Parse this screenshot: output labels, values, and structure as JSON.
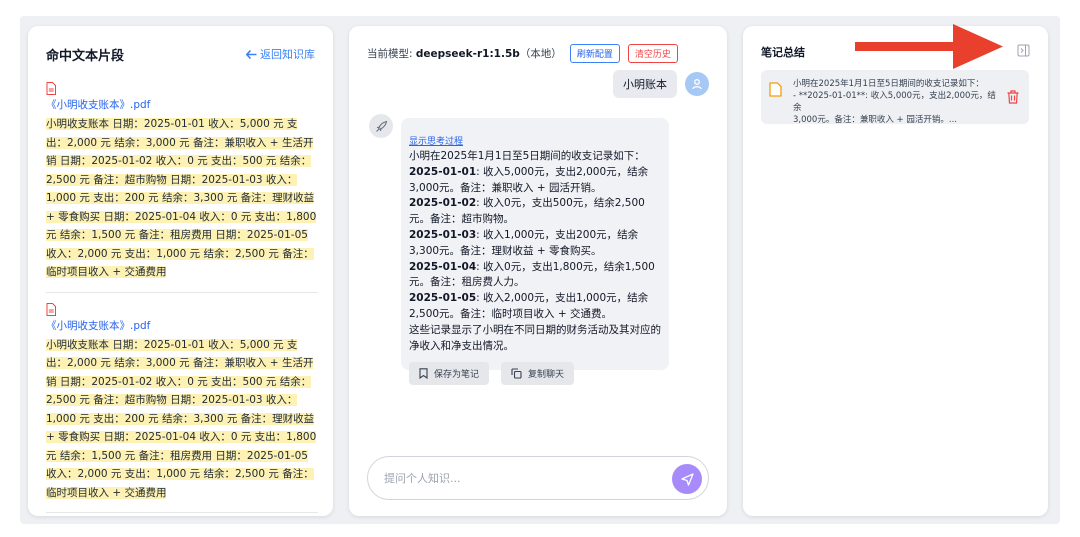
{
  "left": {
    "title": "命中文本片段",
    "back_label": "返回知识库",
    "snippets": [
      {
        "file": "《小明收支账本》.pdf",
        "text": "小明收支账本 日期：2025-01-01 收入：5,000 元 支出：2,000 元 结余：3,000 元 备注：兼职收入 + 生活开销 日期：2025-01-02 收入：0 元 支出：500 元 结余：2,500 元 备注：超市购物 日期：2025-01-03 收入：1,000 元 支出：200 元 结余：3,300 元 备注：理财收益 + 零食购买 日期：2025-01-04 收入：0 元 支出：1,800 元 结余：1,500 元 备注：租房费用 日期：2025-01-05 收入：2,000 元 支出：1,000 元 结余：2,500 元 备注：临时项目收入 + 交通费用"
      },
      {
        "file": "《小明收支账本》.pdf",
        "text": "小明收支账本 日期：2025-01-01 收入：5,000 元 支出：2,000 元 结余：3,000 元 备注：兼职收入 + 生活开销 日期：2025-01-02 收入：0 元 支出：500 元 结余：2,500 元 备注：超市购物 日期：2025-01-03 收入：1,000 元 支出：200 元 结余：3,300 元 备注：理财收益 + 零食购买 日期：2025-01-04 收入：0 元 支出：1,800 元 结余：1,500 元 备注：租房费用 日期：2025-01-05 收入：2,000 元 支出：1,000 元 结余：2,500 元 备注：临时项目收入 + 交通费用"
      }
    ]
  },
  "middle": {
    "model_prefix": "当前模型: ",
    "model_name": "deepseek-r1:1.5b",
    "model_suffix": "（本地）",
    "refresh_label": "刷新配置",
    "clear_label": "清空历史",
    "user_message": "小明账本",
    "think_link": "显示思考过程",
    "answer_intro": "小明在2025年1月1日至5日期间的收支记录如下：",
    "entries": [
      {
        "date": "2025-01-01",
        "line": ": 收入5,000元，支出2,000元，结余3,000元。备注：兼职收入 + 园活开销。"
      },
      {
        "date": "2025-01-02",
        "line": ": 收入0元，支出500元，结余2,500元。备注：超市购物。"
      },
      {
        "date": "2025-01-03",
        "line": ": 收入1,000元，支出200元，结余3,300元。备注：理财收益 + 零食购买。"
      },
      {
        "date": "2025-01-04",
        "line": ": 收入0元，支出1,800元，结余1,500元。备注：租房费人力。"
      },
      {
        "date": "2025-01-05",
        "line": ": 收入2,000元，支出1,000元，结余2,500元。备注：临时项目收入 + 交通费。"
      }
    ],
    "answer_outro": "这些记录显示了小明在不同日期的财务活动及其对应的净收入和净支出情况。",
    "save_note_label": "保存为笔记",
    "copy_chat_label": "复制聊天",
    "input_placeholder": "提问个人知识..."
  },
  "right": {
    "title": "笔记总结",
    "note_line1": "小明在2025年1月1日至5日期间的收支记录如下：",
    "note_line2": "- **2025-01-01**: 收入5,000元，支出2,000元，结余",
    "note_line3": "3,000元。备注：兼职收入 + 园活开销。..."
  },
  "colors": {
    "accent_blue": "#3b82f6",
    "danger_red": "#ef4444",
    "highlight": "#fdf2b3",
    "send_purple": "#a78bfa",
    "arrow_red": "#e8402c"
  },
  "icons": [
    "file-pdf-icon",
    "arrow-left-icon",
    "user-avatar-icon",
    "rocket-icon",
    "bookmark-icon",
    "copy-icon",
    "send-icon",
    "note-icon",
    "trash-icon",
    "collapse-panel-icon",
    "red-arrow-annotation"
  ]
}
